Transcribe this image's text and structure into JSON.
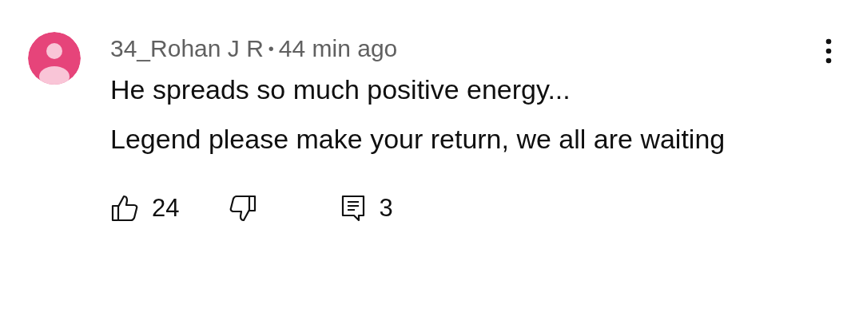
{
  "comment": {
    "author": "34_Rohan J R",
    "separator": "•",
    "time": "44 min ago",
    "text": "He spreads so much positive energy...\nLegend please make your return, we all are waiting",
    "likes": "24",
    "replies": "3"
  }
}
